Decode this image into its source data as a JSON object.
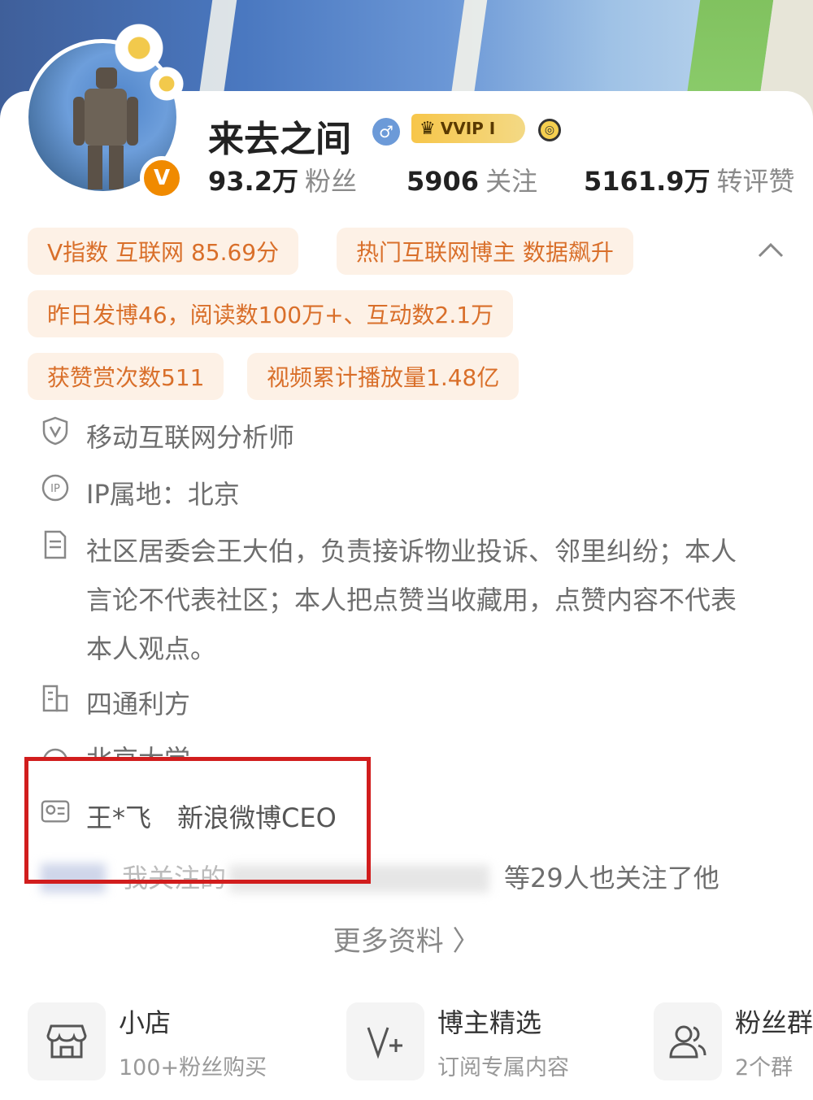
{
  "profile": {
    "name": "来去之间",
    "vip_badge": "VVIP I",
    "avatar_badge": "V"
  },
  "stats": [
    {
      "value": "93.2万",
      "label": "粉丝"
    },
    {
      "value": "5906",
      "label": "关注"
    },
    {
      "value": "5161.9万",
      "label": "转评赞"
    }
  ],
  "tags": [
    "V指数 互联网 85.69分",
    "热门互联网博主 数据飙升",
    "昨日发博46，阅读数100万+、互动数2.1万",
    "获赞赏次数511",
    "视频累计播放量1.48亿"
  ],
  "info": {
    "verification": "移动互联网分析师",
    "ip_location": "IP属地：北京",
    "bio": "社区居委会王大伯，负责接诉物业投诉、邻里纠纷；本人言论不代表社区；本人把点赞当收藏用，点赞内容不代表本人观点。",
    "company": "四通利方",
    "school": "北京大学",
    "contact_name": "王*飞",
    "contact_title": "新浪微博CEO",
    "mutual_prefix": "我关注的",
    "mutual_suffix": "等29人也关注了他"
  },
  "more_link": "更多资料 〉",
  "features": [
    {
      "title": "小店",
      "subtitle": "100+粉丝购买",
      "icon": "shop-icon"
    },
    {
      "title": "博主精选",
      "subtitle": "订阅专属内容",
      "icon": "v-plus-icon"
    },
    {
      "title": "粉丝群",
      "subtitle": "2个群",
      "icon": "group-icon"
    }
  ],
  "colors": {
    "accent": "#f08a00",
    "tag_bg": "#fdf1e6",
    "tag_text": "#d96f2a",
    "highlight": "#d11d1d"
  }
}
